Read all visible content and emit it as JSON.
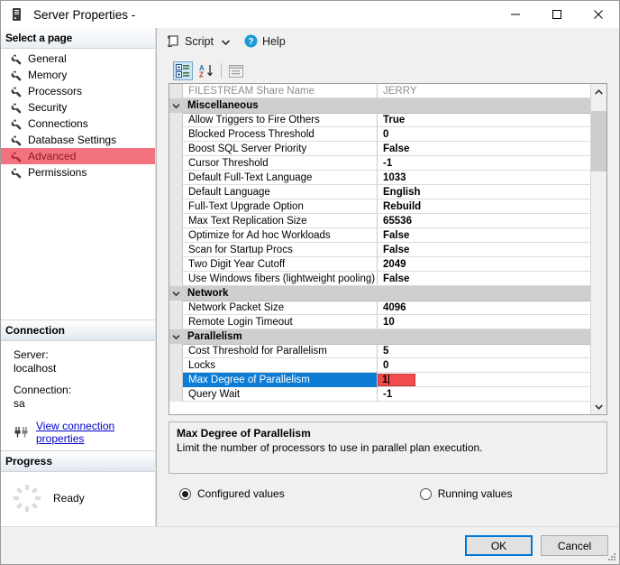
{
  "window": {
    "title": "Server Properties -",
    "icon": "server-tower-icon",
    "minimize_label": "Minimize",
    "maximize_label": "Maximize",
    "close_label": "Close"
  },
  "sidebar": {
    "header": "Select a page",
    "items": [
      {
        "label": "General",
        "icon": "wrench-icon",
        "active": false
      },
      {
        "label": "Memory",
        "icon": "wrench-icon",
        "active": false
      },
      {
        "label": "Processors",
        "icon": "wrench-icon",
        "active": false
      },
      {
        "label": "Security",
        "icon": "wrench-icon",
        "active": false
      },
      {
        "label": "Connections",
        "icon": "wrench-icon",
        "active": false
      },
      {
        "label": "Database Settings",
        "icon": "wrench-icon",
        "active": false
      },
      {
        "label": "Advanced",
        "icon": "wrench-icon",
        "active": true
      },
      {
        "label": "Permissions",
        "icon": "wrench-icon",
        "active": false
      }
    ],
    "active_highlight_color": "#f2737f",
    "active_text_color": "#8f1a22"
  },
  "connection": {
    "header": "Connection",
    "server_label": "Server:",
    "server_value": "localhost",
    "connection_label": "Connection:",
    "connection_value": "sa",
    "link_text": "View connection properties",
    "link_icon": "plug-connector-icon",
    "link_color": "#0000cd"
  },
  "progress": {
    "header": "Progress",
    "status": "Ready",
    "spinner_icon": "loading-spinner-icon"
  },
  "toolbar": {
    "script_label": "Script",
    "script_icon": "script-icon",
    "dropdown_icon": "chevron-down-icon",
    "help_label": "Help",
    "help_icon": "question-mark-icon"
  },
  "grid_toolbar": {
    "categorized_label": "Categorized",
    "categorized_icon": "categorized-view-icon",
    "alphabetical_label": "Alphabetical",
    "alphabetical_icon": "sort-az-icon",
    "property_pages_label": "Property Pages",
    "property_pages_icon": "property-pages-icon",
    "categorized_pressed": true,
    "property_pages_enabled": false
  },
  "grid": {
    "rows": [
      {
        "type": "property",
        "name": "FILESTREAM Share Name",
        "value": "JERRY",
        "dim": true
      },
      {
        "type": "category",
        "name": "Miscellaneous"
      },
      {
        "type": "property",
        "name": "Allow Triggers to Fire Others",
        "value": "True"
      },
      {
        "type": "property",
        "name": "Blocked Process Threshold",
        "value": "0"
      },
      {
        "type": "property",
        "name": "Boost SQL Server Priority",
        "value": "False"
      },
      {
        "type": "property",
        "name": "Cursor Threshold",
        "value": "-1"
      },
      {
        "type": "property",
        "name": "Default Full-Text Language",
        "value": "1033"
      },
      {
        "type": "property",
        "name": "Default Language",
        "value": "English"
      },
      {
        "type": "property",
        "name": "Full-Text Upgrade Option",
        "value": "Rebuild"
      },
      {
        "type": "property",
        "name": "Max Text Replication Size",
        "value": "65536"
      },
      {
        "type": "property",
        "name": "Optimize for Ad hoc Workloads",
        "value": "False"
      },
      {
        "type": "property",
        "name": "Scan for Startup Procs",
        "value": "False"
      },
      {
        "type": "property",
        "name": "Two Digit Year Cutoff",
        "value": "2049"
      },
      {
        "type": "property",
        "name": "Use Windows fibers (lightweight pooling)",
        "value": "False"
      },
      {
        "type": "category",
        "name": "Network"
      },
      {
        "type": "property",
        "name": "Network Packet Size",
        "value": "4096"
      },
      {
        "type": "property",
        "name": "Remote Login Timeout",
        "value": "10"
      },
      {
        "type": "category",
        "name": "Parallelism"
      },
      {
        "type": "property",
        "name": "Cost Threshold for Parallelism",
        "value": "5"
      },
      {
        "type": "property",
        "name": "Locks",
        "value": "0"
      },
      {
        "type": "property",
        "name": "Max Degree of Parallelism",
        "value": "1",
        "selected": true,
        "editing": true
      },
      {
        "type": "property",
        "name": "Query Wait",
        "value": "-1"
      }
    ],
    "selection_color": "#0c7cd5",
    "edit_color": "#f24b4b",
    "scrollbar": {
      "up_icon": "chevron-up-icon",
      "down_icon": "chevron-down-icon",
      "thumb_top_pct": 4,
      "thumb_height_pct": 20
    }
  },
  "description": {
    "title": "Max Degree of Parallelism",
    "text": "Limit the number of processors to use in parallel plan execution."
  },
  "value_mode": {
    "options": [
      {
        "label": "Configured values",
        "selected": true
      },
      {
        "label": "Running values",
        "selected": false
      }
    ]
  },
  "footer": {
    "ok_label": "OK",
    "cancel_label": "Cancel",
    "default_button": "OK",
    "resize_grip_icon": "resize-grip-icon"
  }
}
